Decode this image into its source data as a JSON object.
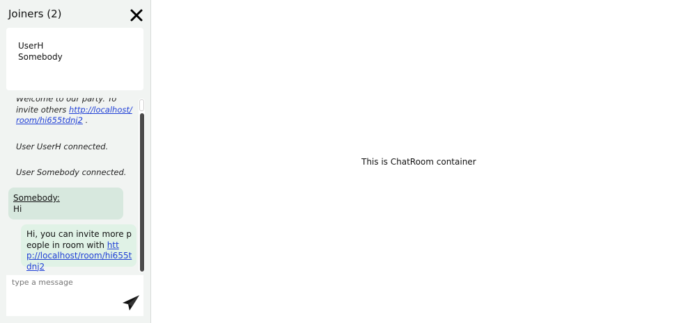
{
  "sidebar": {
    "title": "Joiners (2)",
    "joiners": [
      "UserH",
      "Somebody"
    ],
    "messages": {
      "welcome_prefix": "Welcome to our party. To invite others ",
      "welcome_link": "http://localhost/room/hi655tdnj2",
      "welcome_suffix": " .",
      "connected_1": "User UserH connected.",
      "connected_2": "User Somebody connected.",
      "incoming": {
        "sender": "Somebody:",
        "text": "Hi"
      },
      "outgoing": {
        "prefix": "Hi, you can invite more people in room with ",
        "link": "http://localhost/room/hi655tdnj2"
      }
    },
    "input": {
      "placeholder": "type a message",
      "value": ""
    },
    "icons": {
      "close": "close-icon",
      "send": "paper-plane-icon"
    }
  },
  "main": {
    "text": "This is ChatRoom container"
  }
}
